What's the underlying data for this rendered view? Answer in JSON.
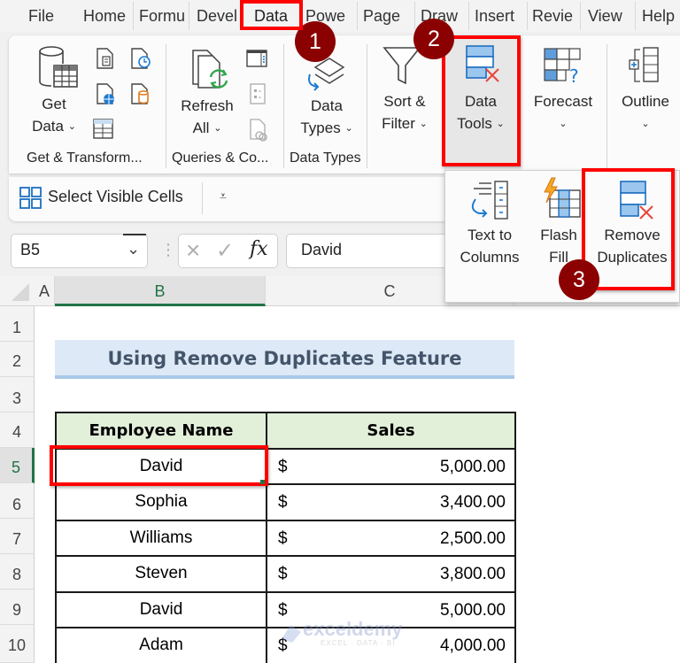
{
  "tabs": [
    {
      "label": "File"
    },
    {
      "label": "Home"
    },
    {
      "label": "Formu"
    },
    {
      "label": "Devel"
    },
    {
      "label": "Data",
      "active": true
    },
    {
      "label": "Powe"
    },
    {
      "label": "Page"
    },
    {
      "label": "Draw"
    },
    {
      "label": "Insert"
    },
    {
      "label": "Revie"
    },
    {
      "label": "View"
    },
    {
      "label": "Help"
    }
  ],
  "ribbon": {
    "get_data": {
      "line1": "Get",
      "line2": "Data"
    },
    "refresh_all": {
      "line1": "Refresh",
      "line2": "All"
    },
    "data_types": {
      "line1": "Data",
      "line2": "Types"
    },
    "sort_filter": {
      "line1": "Sort &",
      "line2": "Filter"
    },
    "data_tools": {
      "line1": "Data",
      "line2": "Tools"
    },
    "forecast": {
      "line1": "Forecast"
    },
    "outline": {
      "line1": "Outline"
    },
    "groups": {
      "get_transform": "Get & Transform...",
      "queries": "Queries & Co...",
      "data_types": "Data Types"
    }
  },
  "qat": {
    "select_visible_cells": "Select Visible Cells",
    "customize_icon": "customize-qat-icon"
  },
  "data_tools_menu": {
    "text_to_columns": {
      "line1": "Text to",
      "line2": "Columns"
    },
    "flash_fill": {
      "line1": "Flash",
      "line2": "Fill"
    },
    "remove_duplicates": {
      "line1": "Remove",
      "line2": "Duplicates"
    }
  },
  "formula_bar": {
    "name_box": "B5",
    "cancel_icon": "×",
    "enter_icon": "✓",
    "fx_label": "fx",
    "formula_value": "David"
  },
  "grid": {
    "columns": [
      "A",
      "B",
      "C"
    ],
    "rows": [
      "1",
      "2",
      "3",
      "4",
      "5",
      "6",
      "7",
      "8",
      "9",
      "10"
    ],
    "selected_cell": "B5"
  },
  "sheet": {
    "title": "Using Remove Duplicates Feature",
    "headers": [
      "Employee Name",
      "Sales"
    ],
    "rows": [
      {
        "name": "David",
        "currency": "$",
        "amount": "5,000.00"
      },
      {
        "name": "Sophia",
        "currency": "$",
        "amount": "3,400.00"
      },
      {
        "name": "Williams",
        "currency": "$",
        "amount": "2,500.00"
      },
      {
        "name": "Steven",
        "currency": "$",
        "amount": "3,800.00"
      },
      {
        "name": "David",
        "currency": "$",
        "amount": "5,000.00"
      },
      {
        "name": "Adam",
        "currency": "$",
        "amount": "4,000.00"
      }
    ]
  },
  "annotations": {
    "step1": "1",
    "step2": "2",
    "step3": "3",
    "highlight_color": "#ff0000",
    "badge_color": "#8b0000"
  },
  "watermark": {
    "brand": "exceldemy",
    "tagline": "EXCEL · DATA · BI"
  }
}
